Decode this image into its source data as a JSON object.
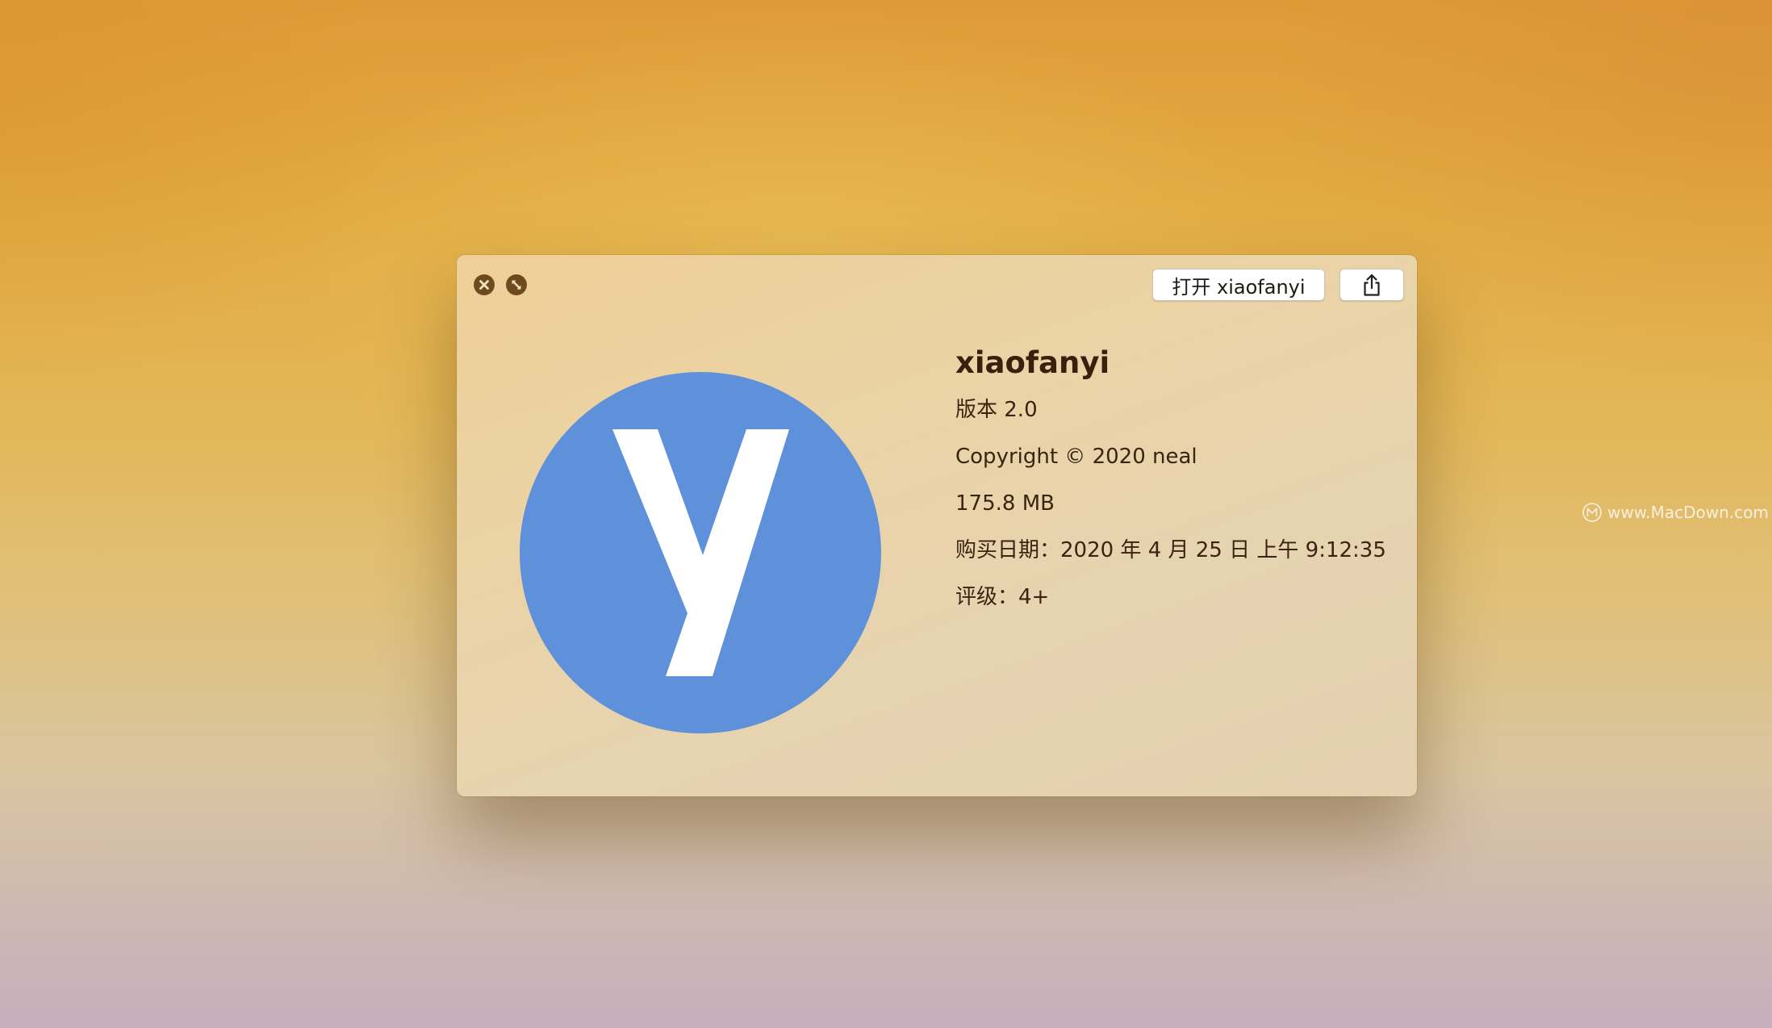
{
  "window": {
    "close_icon": "close-icon",
    "fullscreen_icon": "fullscreen-icon",
    "open_button_label": "打开 xiaofanyi",
    "share_icon": "share-icon"
  },
  "app": {
    "icon": "xiaofanyi-app-icon",
    "icon_letter": "y",
    "icon_color": "#5f90da",
    "name": "xiaofanyi",
    "version": "版本 2.0",
    "copyright": "Copyright © 2020 neal",
    "size": "175.8 MB",
    "purchase_date": "购买日期：2020 年 4 月 25 日 上午 9:12:35",
    "rating": "评级：4+"
  },
  "watermark": {
    "icon": "macdown-logo-icon",
    "text": "www.MacDown.com"
  }
}
